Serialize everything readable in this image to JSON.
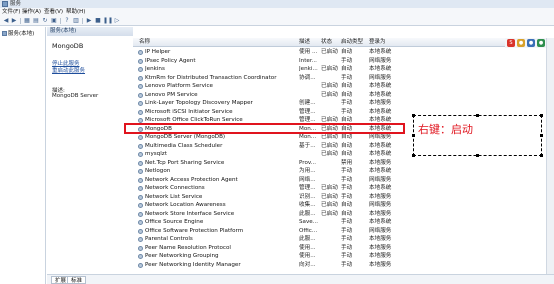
{
  "window": {
    "title": "服务"
  },
  "menu": [
    "文件(F)",
    "操作(A)",
    "查看(V)",
    "帮助(H)"
  ],
  "toolbar": {
    "buttons": [
      "back-icon",
      "forward-icon",
      "show-hide-tree-icon",
      "properties-icon",
      "refresh-icon",
      "export-list-icon",
      "help-icon",
      "view-icon",
      "start-icon",
      "stop-icon",
      "pause-icon",
      "restart-icon"
    ]
  },
  "tree": {
    "root_label": "服务(本地)"
  },
  "detail": {
    "header": "服务(本地)",
    "service_title": "MongoDB",
    "link_stop": "停止此服务",
    "link_restart": "重启动此服务",
    "desc_label": "描述:",
    "desc_value": "MongoDB Server"
  },
  "columns": {
    "name": "名称",
    "desc": "描述",
    "status": "状态",
    "startup": "启动类型",
    "logon": "登录为"
  },
  "rows": [
    {
      "name": "IP Helper",
      "desc": "使用 ...",
      "status": "已启动",
      "startup": "自动",
      "logon": "本地系统"
    },
    {
      "name": "IPsec Policy Agent",
      "desc": "Inter...",
      "status": "",
      "startup": "手动",
      "logon": "网络服务"
    },
    {
      "name": "Jenkins",
      "desc": "Jenki...",
      "status": "已启动",
      "startup": "自动",
      "logon": "本地系统"
    },
    {
      "name": "KtmRm for Distributed Transaction Coordinator",
      "desc": "协调...",
      "status": "",
      "startup": "手动",
      "logon": "网络服务"
    },
    {
      "name": "Lenovo Platform Service",
      "desc": "",
      "status": "已启动",
      "startup": "自动",
      "logon": "本地系统"
    },
    {
      "name": "Lenovo PM Service",
      "desc": "",
      "status": "已启动",
      "startup": "自动",
      "logon": "本地系统"
    },
    {
      "name": "Link-Layer Topology Discovery Mapper",
      "desc": "创建...",
      "status": "",
      "startup": "手动",
      "logon": "本地服务"
    },
    {
      "name": "Microsoft iSCSI Initiator Service",
      "desc": "管理...",
      "status": "",
      "startup": "手动",
      "logon": "本地系统"
    },
    {
      "name": "Microsoft Office ClickToRun Service",
      "desc": "管理...",
      "status": "已启动",
      "startup": "自动",
      "logon": "本地系统"
    },
    {
      "name": "MongoDB",
      "desc": "Mon...",
      "status": "已启动",
      "startup": "自动",
      "logon": "本地系统"
    },
    {
      "name": "MongoDB Server (MongoDB)",
      "desc": "Mon...",
      "status": "已启动",
      "startup": "自动",
      "logon": "网络服务"
    },
    {
      "name": "Multimedia Class Scheduler",
      "desc": "基于...",
      "status": "已启动",
      "startup": "自动",
      "logon": "本地系统"
    },
    {
      "name": "mysqlzt",
      "desc": "",
      "status": "已启动",
      "startup": "自动",
      "logon": "本地系统"
    },
    {
      "name": "Net.Tcp Port Sharing Service",
      "desc": "Prov...",
      "status": "",
      "startup": "禁用",
      "logon": "本地服务"
    },
    {
      "name": "Netlogon",
      "desc": "为用...",
      "status": "",
      "startup": "手动",
      "logon": "本地系统"
    },
    {
      "name": "Network Access Protection Agent",
      "desc": "网络...",
      "status": "",
      "startup": "手动",
      "logon": "网络服务"
    },
    {
      "name": "Network Connections",
      "desc": "管理...",
      "status": "已启动",
      "startup": "手动",
      "logon": "本地系统"
    },
    {
      "name": "Network List Service",
      "desc": "识别...",
      "status": "已启动",
      "startup": "手动",
      "logon": "本地服务"
    },
    {
      "name": "Network Location Awareness",
      "desc": "收集...",
      "status": "已启动",
      "startup": "自动",
      "logon": "网络服务"
    },
    {
      "name": "Network Store Interface Service",
      "desc": "此服...",
      "status": "已启动",
      "startup": "自动",
      "logon": "本地服务"
    },
    {
      "name": "Office Source Engine",
      "desc": "Save...",
      "status": "",
      "startup": "手动",
      "logon": "本地系统"
    },
    {
      "name": "Office Software Protection Platform",
      "desc": "Offic...",
      "status": "",
      "startup": "手动",
      "logon": "网络服务"
    },
    {
      "name": "Parental Controls",
      "desc": "此服...",
      "status": "",
      "startup": "手动",
      "logon": "本地服务"
    },
    {
      "name": "Peer Name Resolution Protocol",
      "desc": "使用...",
      "status": "",
      "startup": "手动",
      "logon": "本地服务"
    },
    {
      "name": "Peer Networking Grouping",
      "desc": "使用...",
      "status": "",
      "startup": "手动",
      "logon": "本地服务"
    },
    {
      "name": "Peer Networking Identity Manager",
      "desc": "向对...",
      "status": "",
      "startup": "手动",
      "logon": "本地服务"
    }
  ],
  "annotation": {
    "text": "右键：启动"
  },
  "bottom_tabs": [
    "扩展",
    "标准"
  ],
  "colors": {
    "highlight": "#e0141e",
    "accent": "#1f4e9c"
  }
}
